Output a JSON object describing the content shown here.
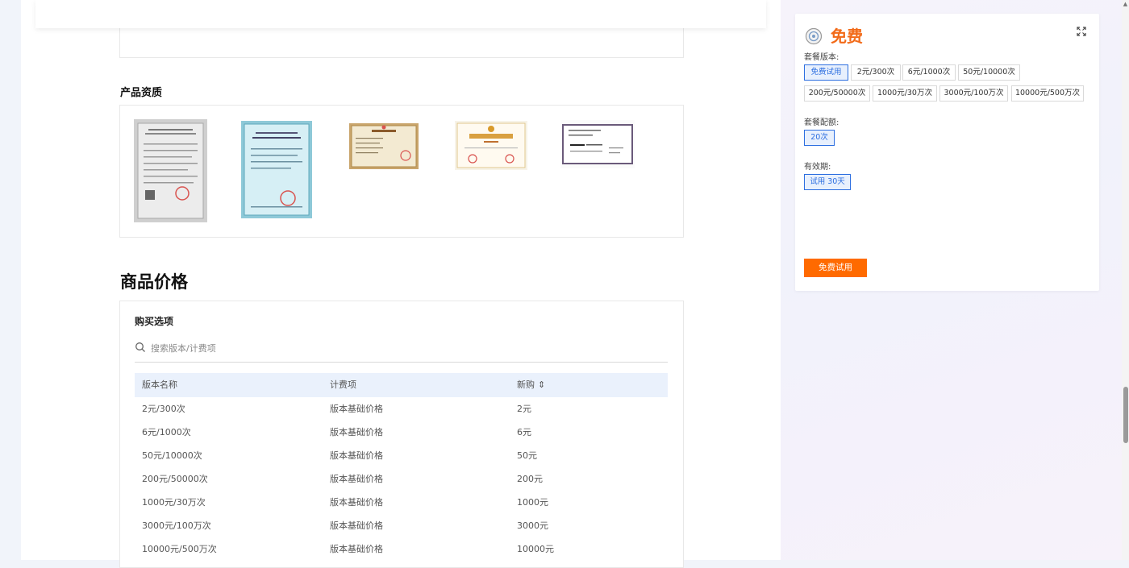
{
  "sections": {
    "qualification_title": "产品资质",
    "price_title": "商品价格"
  },
  "purchase": {
    "title": "购买选项",
    "search_placeholder": "搜索版本/计费项",
    "columns": [
      "版本名称",
      "计费项",
      "新购"
    ],
    "rows": [
      {
        "name": "2元/300次",
        "item": "版本基础价格",
        "price": "2元"
      },
      {
        "name": "6元/1000次",
        "item": "版本基础价格",
        "price": "6元"
      },
      {
        "name": "50元/10000次",
        "item": "版本基础价格",
        "price": "50元"
      },
      {
        "name": "200元/50000次",
        "item": "版本基础价格",
        "price": "200元"
      },
      {
        "name": "1000元/30万次",
        "item": "版本基础价格",
        "price": "1000元"
      },
      {
        "name": "3000元/100万次",
        "item": "版本基础价格",
        "price": "3000元"
      },
      {
        "name": "10000元/500万次",
        "item": "版本基础价格",
        "price": "10000元"
      }
    ]
  },
  "card": {
    "title": "免费",
    "version_label": "套餐版本:",
    "versions": [
      "免费试用",
      "2元/300次",
      "6元/1000次",
      "50元/10000次",
      "200元/50000次",
      "1000元/30万次",
      "3000元/100万次",
      "10000元/500万次"
    ],
    "quota_label": "套餐配额:",
    "quota": "20次",
    "validity_label": "有效期:",
    "validity": "试用 30天",
    "cta": "免费试用"
  },
  "icons": {
    "search": "search-icon",
    "expand": "expand-icon",
    "sort": "sort-icon",
    "logo": "product-logo-icon"
  },
  "colors": {
    "accent_orange": "#ff6a00",
    "title_orange": "#f26a18",
    "selected_blue": "#2c6ee0",
    "table_header": "#eaf1fc"
  }
}
